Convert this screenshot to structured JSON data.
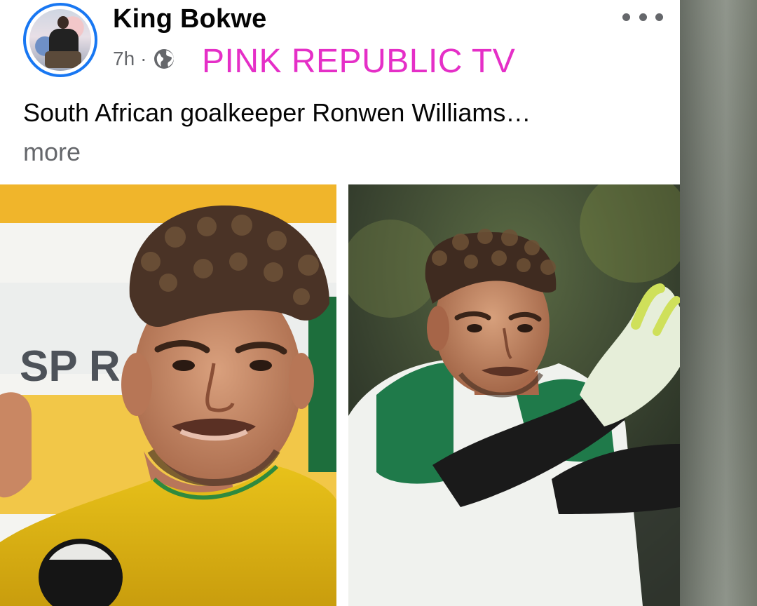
{
  "post": {
    "author_name": "King Bokwe",
    "time": "7h",
    "separator": "·",
    "privacy_icon": "globe-icon",
    "page_tag": "PINK REPUBLIC TV",
    "page_tag_color": "#e52fc7",
    "text": "South African goalkeeper Ronwen Williams…",
    "see_more_label": "more",
    "options_icon": "more-options-icon"
  },
  "photos": {
    "left": {
      "backdrop_text": "SP  R"
    },
    "right": {}
  },
  "colors": {
    "accent": "#1877f2",
    "secondary_text": "#65676b",
    "primary_text": "#050505"
  }
}
